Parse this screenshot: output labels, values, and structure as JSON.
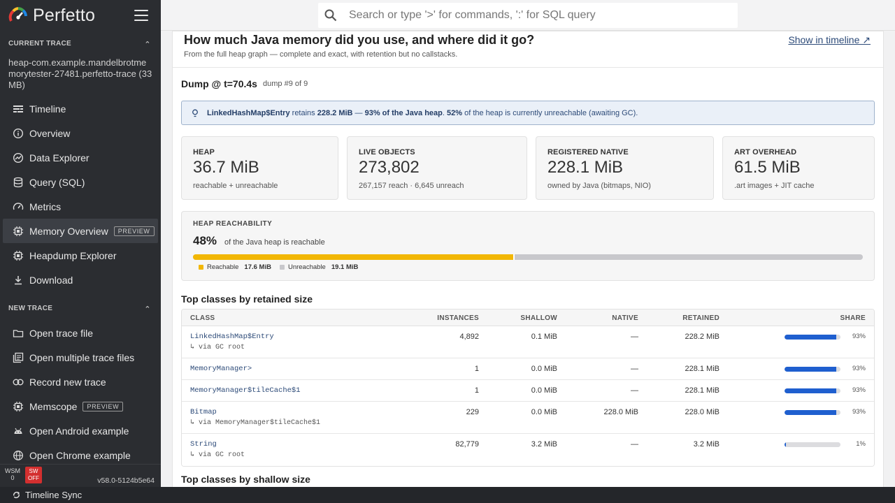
{
  "brand": {
    "name": "Perfetto"
  },
  "sidebar": {
    "current_trace_header": "CURRENT TRACE",
    "trace_name": "heap-com.example.mandelbrotmemorytester-27481.perfetto-trace (33 MB)",
    "trace_items": [
      {
        "label": "Timeline",
        "icon": "timeline-icon"
      },
      {
        "label": "Overview",
        "icon": "info-icon"
      },
      {
        "label": "Data Explorer",
        "icon": "chart-icon"
      },
      {
        "label": "Query (SQL)",
        "icon": "database-icon"
      },
      {
        "label": "Metrics",
        "icon": "speedometer-icon"
      },
      {
        "label": "Memory Overview",
        "icon": "memory-chip-icon",
        "badge": "PREVIEW"
      },
      {
        "label": "Heapdump Explorer",
        "icon": "memory-chip-icon"
      },
      {
        "label": "Download",
        "icon": "download-icon"
      }
    ],
    "new_trace_header": "NEW TRACE",
    "new_items": [
      {
        "label": "Open trace file",
        "icon": "folder-icon"
      },
      {
        "label": "Open multiple trace files",
        "icon": "library-icon"
      },
      {
        "label": "Record new trace",
        "icon": "record-icon"
      },
      {
        "label": "Memscope",
        "icon": "memory-chip-icon",
        "badge": "PREVIEW"
      },
      {
        "label": "Open Android example",
        "icon": "android-icon"
      },
      {
        "label": "Open Chrome example",
        "icon": "globe-icon"
      }
    ],
    "footer": {
      "wsm_label": "WSM",
      "wsm_value": "0",
      "sw_label": "SW",
      "sw_value": "OFF",
      "version": "v58.0-5124b5e64"
    }
  },
  "bottombar": {
    "label": "Timeline Sync"
  },
  "search": {
    "placeholder": "Search or type '>' for commands, ':' for SQL query"
  },
  "page": {
    "title": "How much Java memory did you use, and where did it go?",
    "subtitle": "From the full heap graph — complete and exact, with retention but no callstacks.",
    "show_timeline": "Show in timeline ↗",
    "dump_title": "Dump @ t=70.4s",
    "dump_meta": "dump #9 of 9",
    "insight": {
      "class_name": "LinkedHashMap$Entry",
      "t1": " retains ",
      "retained": "228.2 MiB",
      "t2": " — ",
      "pct_heap": "93% of the Java heap",
      "t3": ". ",
      "unreach_pct": "52%",
      "t4": " of the heap is currently unreachable (awaiting GC)."
    },
    "stats": [
      {
        "label": "HEAP",
        "value": "36.7 MiB",
        "sub": "reachable + unreachable"
      },
      {
        "label": "LIVE OBJECTS",
        "value": "273,802",
        "sub": "267,157 reach · 6,645 unreach"
      },
      {
        "label": "REGISTERED NATIVE",
        "value": "228.1 MiB",
        "sub": "owned by Java (bitmaps, NIO)"
      },
      {
        "label": "ART OVERHEAD",
        "value": "61.5 MiB",
        "sub": ".art images + JIT cache"
      }
    ],
    "reachability": {
      "label": "HEAP REACHABILITY",
      "pct": "48%",
      "text": "of the Java heap is reachable",
      "fraction": 0.48,
      "reachable_label": "Reachable",
      "reachable_value": "17.6 MiB",
      "unreachable_label": "Unreachable",
      "unreachable_value": "19.1 MiB",
      "reachable_color": "#f2b705",
      "unreachable_color": "#c8c8cc"
    },
    "table_title": "Top classes by retained size",
    "table_title2": "Top classes by shallow size",
    "columns": {
      "class": "CLASS",
      "instances": "INSTANCES",
      "shallow": "SHALLOW",
      "native": "NATIVE",
      "retained": "RETAINED",
      "share": "SHARE"
    },
    "rows": [
      {
        "class": "LinkedHashMap$Entry",
        "via": "↳ via GC root",
        "instances": "4,892",
        "shallow": "0.1 MiB",
        "native": "—",
        "retained": "228.2 MiB",
        "share": "93%",
        "share_frac": 0.93
      },
      {
        "class": "MemoryManager>",
        "via": "",
        "instances": "1",
        "shallow": "0.0 MiB",
        "native": "—",
        "retained": "228.1 MiB",
        "share": "93%",
        "share_frac": 0.93
      },
      {
        "class": "MemoryManager$tileCache$1",
        "via": "",
        "instances": "1",
        "shallow": "0.0 MiB",
        "native": "—",
        "retained": "228.1 MiB",
        "share": "93%",
        "share_frac": 0.93
      },
      {
        "class": "Bitmap",
        "via": "↳ via MemoryManager$tileCache$1",
        "instances": "229",
        "shallow": "0.0 MiB",
        "native": "228.0 MiB",
        "retained": "228.0 MiB",
        "share": "93%",
        "share_frac": 0.93
      },
      {
        "class": "String",
        "via": "↳ via GC root",
        "instances": "82,779",
        "shallow": "3.2 MiB",
        "native": "—",
        "retained": "3.2 MiB",
        "share": "1%",
        "share_frac": 0.01
      }
    ]
  }
}
